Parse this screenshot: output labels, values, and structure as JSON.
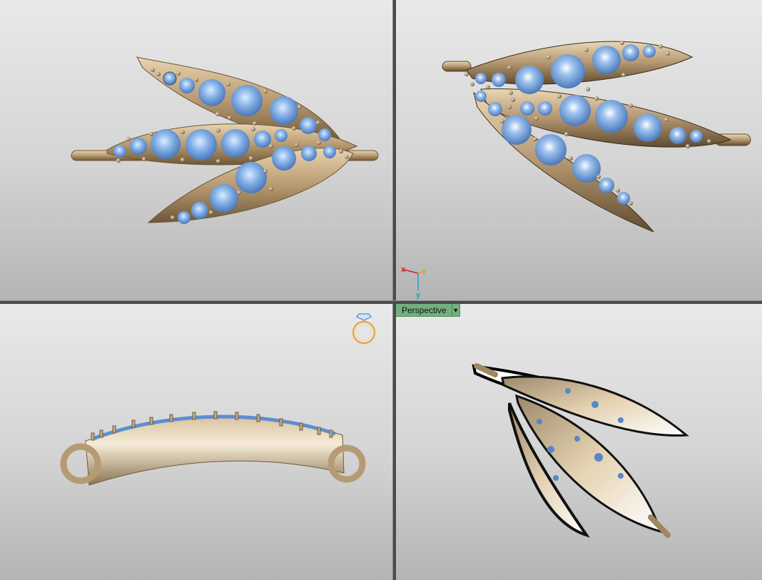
{
  "viewports": {
    "top_left": {
      "name": "top-view"
    },
    "top_right": {
      "name": "front-view"
    },
    "bottom_left": {
      "name": "side-view"
    },
    "bottom_right": {
      "name": "perspective-view",
      "label": "Perspective",
      "dropdown_icon": "triangle-down-icon"
    }
  },
  "axis_gizmo": {
    "x": "x",
    "y": "y",
    "z": "z",
    "colors": {
      "x": "#d02020",
      "y": "#20a0c0",
      "z": "#e0a020"
    }
  },
  "ring_icon": {
    "icon": "ring-with-diamond-icon",
    "color": "#e8a848"
  },
  "colors": {
    "metal": "#c9b08a",
    "metal_dark": "#7d6748",
    "gem": "#7ba6e0",
    "gem_highlight": "#eaf6ff",
    "label_bg": "#74b07f"
  }
}
